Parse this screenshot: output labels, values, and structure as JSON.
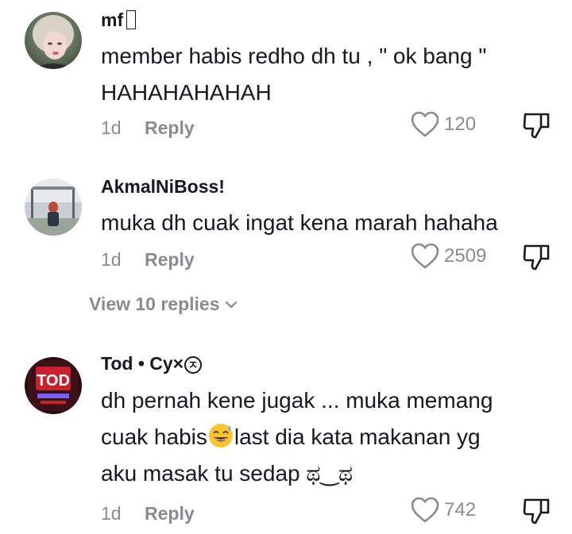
{
  "comments": [
    {
      "username": "mf",
      "text_line1": "member habis redho dh tu , \" ok bang \"",
      "text_line2": "HAHAHAHAHAH",
      "date": "1d",
      "reply_label": "Reply",
      "likes": "120"
    },
    {
      "username": "AkmalNiBoss!",
      "text_line1": "muka dh cuak ingat kena marah hahaha",
      "date": "1d",
      "reply_label": "Reply",
      "likes": "2509",
      "view_replies": "View 10 replies"
    },
    {
      "username_main": "Tod • Cy×",
      "username_badge": "ㅈ",
      "text_line1": "dh pernah kene jugak ... muka memang",
      "text_line2a": "cuak habis",
      "text_line2b": "last dia kata makanan yg",
      "text_line3": "aku masak tu sedap ಥ‿ಥ",
      "date": "1d",
      "reply_label": "Reply",
      "likes": "742",
      "avatar_text": "TOD"
    }
  ],
  "icons": {
    "like": "heart-outline-icon",
    "dislike": "thumbs-down-icon",
    "chevron": "chevron-down-icon",
    "emoji": "grinning-sweat-emoji"
  },
  "colors": {
    "text": "#161823",
    "muted": "#8a8b91"
  }
}
